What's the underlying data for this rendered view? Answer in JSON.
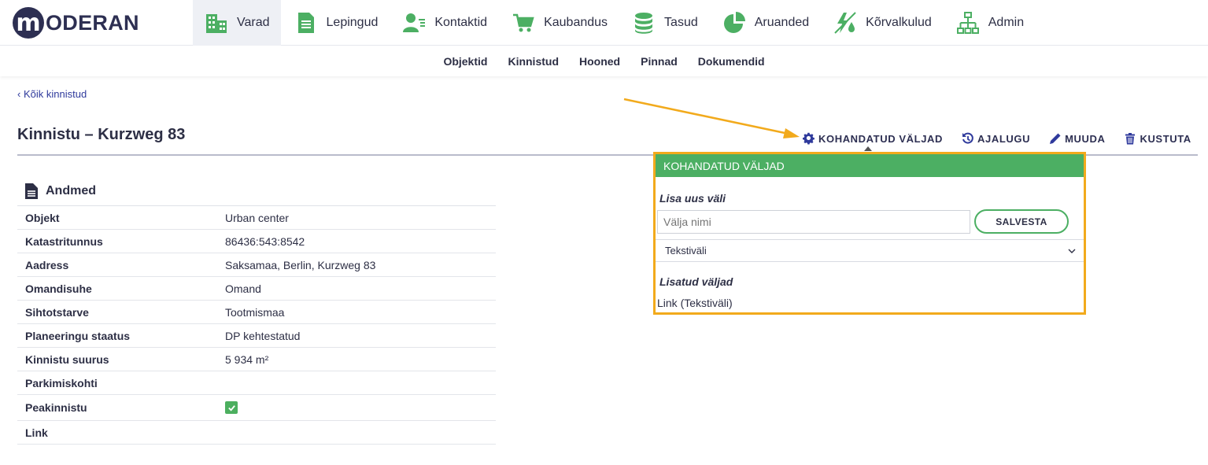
{
  "brand": {
    "logo_letter": "m",
    "logo_text": "ODERAN"
  },
  "nav": {
    "items": [
      {
        "label": "Varad",
        "icon": "buildings-icon",
        "active": true
      },
      {
        "label": "Lepingud",
        "icon": "document-icon"
      },
      {
        "label": "Kontaktid",
        "icon": "contacts-icon"
      },
      {
        "label": "Kaubandus",
        "icon": "cart-icon"
      },
      {
        "label": "Tasud",
        "icon": "coins-icon"
      },
      {
        "label": "Aruanded",
        "icon": "pie-chart-icon"
      },
      {
        "label": "Kõrvalkulud",
        "icon": "utilities-icon"
      },
      {
        "label": "Admin",
        "icon": "org-chart-icon"
      }
    ]
  },
  "subnav": {
    "items": [
      "Objektid",
      "Kinnistud",
      "Hooned",
      "Pinnad",
      "Dokumendid"
    ]
  },
  "page": {
    "back_link": "Kõik kinnistud",
    "back_chevron": "‹",
    "title": "Kinnistu – Kurzweg 83"
  },
  "actions": {
    "custom_fields": "KOHANDATUD VÄLJAD",
    "history": "AJALUGU",
    "edit": "MUUDA",
    "delete": "KUSTUTA"
  },
  "data_section": {
    "title": "Andmed",
    "rows": [
      {
        "label": "Objekt",
        "value": "Urban center"
      },
      {
        "label": "Katastritunnus",
        "value": "86436:543:8542"
      },
      {
        "label": "Aadress",
        "value": "Saksamaa, Berlin, Kurzweg 83"
      },
      {
        "label": "Omandisuhe",
        "value": "Omand"
      },
      {
        "label": "Sihtotstarve",
        "value": "Tootmismaa"
      },
      {
        "label": "Planeeringu staatus",
        "value": "DP kehtestatud"
      },
      {
        "label": "Kinnistu suurus",
        "value": "5 934 m²"
      },
      {
        "label": "Parkimiskohti",
        "value": ""
      },
      {
        "label": "Peakinnistu",
        "value": "",
        "checked": true
      },
      {
        "label": "Link",
        "value": ""
      }
    ]
  },
  "custom_fields_panel": {
    "header": "KOHANDATUD VÄLJAD",
    "add_new_label": "Lisa uus väli",
    "name_placeholder": "Välja nimi",
    "save_label": "SALVESTA",
    "type_selected": "Tekstiväli",
    "added_label": "Lisatud väljad",
    "added_items": [
      "Link (Tekstiväli)"
    ]
  },
  "colors": {
    "brand_dark": "#2d2f52",
    "accent_green": "#4caf63",
    "highlight_orange": "#f2aa1c",
    "link_blue": "#2f3a9c"
  }
}
